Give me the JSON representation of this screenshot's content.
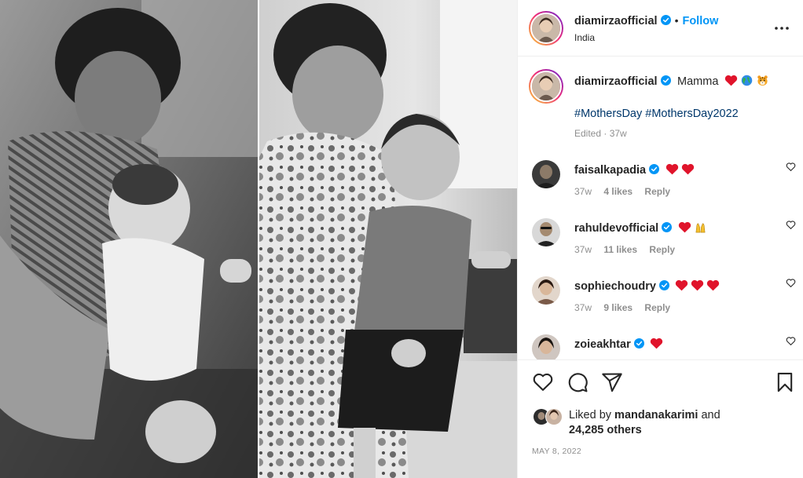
{
  "post": {
    "author": "diamirzaofficial",
    "location": "India",
    "follow_label": "Follow",
    "separator": "•",
    "more_label": "•••"
  },
  "caption": {
    "author": "diamirzaofficial",
    "text": "Mamma",
    "hashtags": "#MothersDay #MothersDay2022",
    "meta": "Edited · 37w",
    "emojis": [
      "red-heart",
      "globe",
      "tiger-face"
    ]
  },
  "comments": [
    {
      "user": "faisalkapadia",
      "time": "37w",
      "likes": "4 likes",
      "reply": "Reply",
      "emojis": [
        "red-heart",
        "red-heart"
      ]
    },
    {
      "user": "rahuldevofficial",
      "time": "37w",
      "likes": "11 likes",
      "reply": "Reply",
      "emojis": [
        "red-heart",
        "raising-hands"
      ]
    },
    {
      "user": "sophiechoudry",
      "time": "37w",
      "likes": "9 likes",
      "reply": "Reply",
      "emojis": [
        "red-heart",
        "red-heart",
        "red-heart"
      ]
    },
    {
      "user": "zoieakhtar",
      "time": "",
      "likes": "",
      "reply": "",
      "emojis": [
        "red-heart"
      ]
    }
  ],
  "likes": {
    "prefix": "Liked by",
    "user": "mandanakarimi",
    "middle": "and",
    "count": "24,285 others"
  },
  "date": "MAY 8, 2022",
  "colors": {
    "accent": "#0095f6",
    "hashtag": "#00376b",
    "muted": "#8e8e8e",
    "heart": "#e0142b"
  }
}
